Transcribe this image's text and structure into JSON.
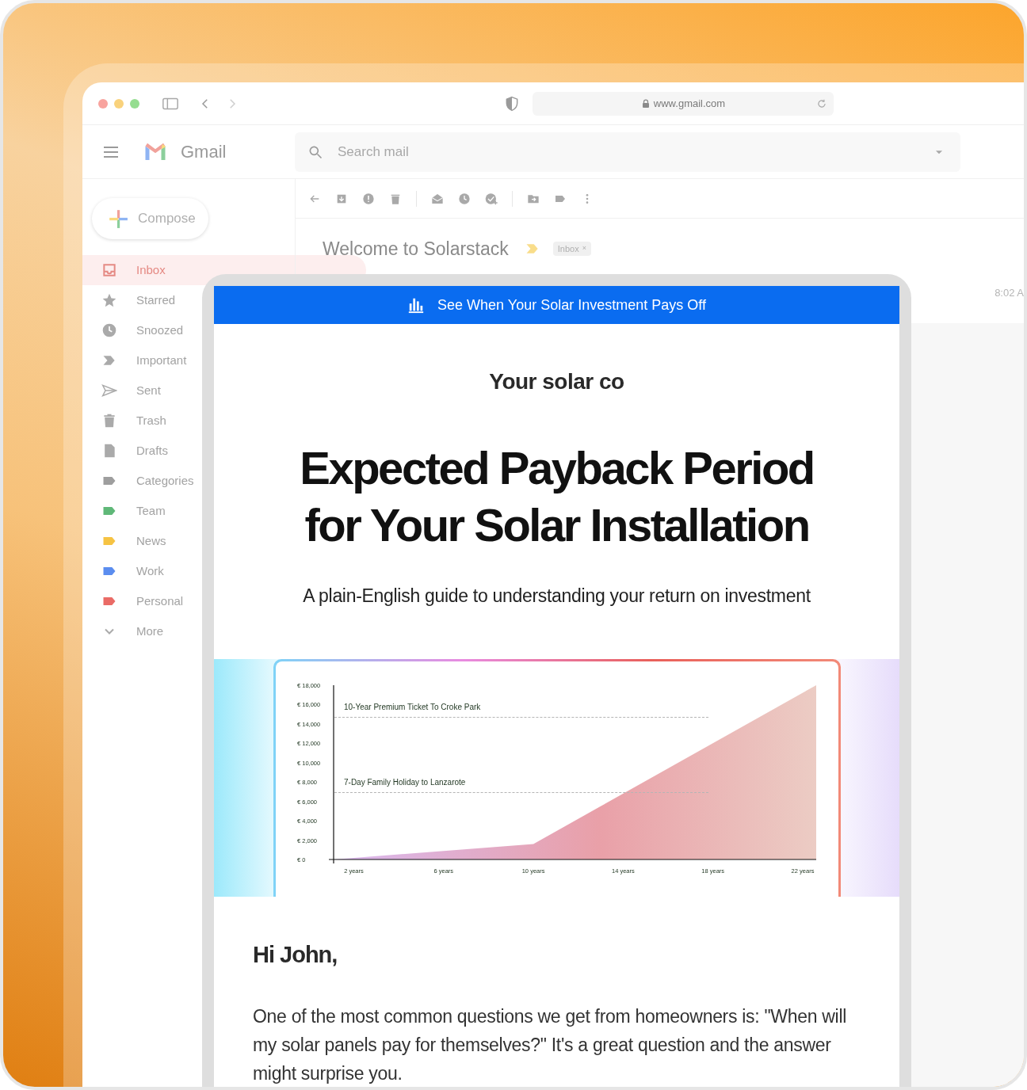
{
  "browser": {
    "url": "www.gmail.com"
  },
  "gmail": {
    "app_name": "Gmail",
    "search": {
      "placeholder": "Search mail"
    },
    "compose": "Compose",
    "sidebar": {
      "items": [
        {
          "label": "Inbox",
          "kind": "inbox",
          "selected": true
        },
        {
          "label": "Starred",
          "kind": "star",
          "selected": false
        },
        {
          "label": "Snoozed",
          "kind": "clock",
          "selected": false
        },
        {
          "label": "Important",
          "kind": "important",
          "selected": false
        },
        {
          "label": "Sent",
          "kind": "sent",
          "selected": false
        },
        {
          "label": "Trash",
          "kind": "trash",
          "selected": false
        },
        {
          "label": "Drafts",
          "kind": "draft",
          "selected": false
        },
        {
          "label": "Categories",
          "kind": "label",
          "color": "#9e9e9e",
          "selected": false
        },
        {
          "label": "Team",
          "kind": "label",
          "color": "#5fb878",
          "selected": false
        },
        {
          "label": "News",
          "kind": "label",
          "color": "#f6c343",
          "selected": false
        },
        {
          "label": "Work",
          "kind": "label",
          "color": "#5b8def",
          "selected": false
        },
        {
          "label": "Personal",
          "kind": "label",
          "color": "#ea6b66",
          "selected": false
        },
        {
          "label": "More",
          "kind": "more",
          "selected": false
        }
      ]
    },
    "thread": {
      "subject": "Welcome to Solarstack",
      "chip": "Inbox",
      "chip_close": "×",
      "time": "8:02 A"
    }
  },
  "email": {
    "banner": "See When Your Solar Investment Pays Off",
    "sender": "Your solar co",
    "headline": "Expected Payback Period for Your Solar Installation",
    "subtitle": "A plain-English guide to understanding your return on investment",
    "chart_data": {
      "type": "area",
      "x": [
        1.1,
        10,
        22.6
      ],
      "series": [
        {
          "color": "#e9a0a8",
          "values": [
            0,
            1600,
            18000
          ]
        }
      ],
      "xlim": [
        1.1,
        22.6
      ],
      "ylim": [
        0,
        18000
      ],
      "xticks": [
        {
          "value": 2,
          "label": "2 years"
        },
        {
          "value": 6,
          "label": "6 years"
        },
        {
          "value": 10,
          "label": "10 years"
        },
        {
          "value": 14,
          "label": "14 years"
        },
        {
          "value": 18,
          "label": "18 years"
        },
        {
          "value": 22,
          "label": "22 years"
        }
      ],
      "yticks": [
        {
          "value": 18000,
          "label": "€ 18,000"
        },
        {
          "value": 16000,
          "label": "€ 16,000"
        },
        {
          "value": 14000,
          "label": "€ 14,000"
        },
        {
          "value": 12000,
          "label": "€ 12,000"
        },
        {
          "value": 10000,
          "label": "€ 10,000"
        },
        {
          "value": 8000,
          "label": "€ 8,000"
        },
        {
          "value": 6000,
          "label": "€ 6,000"
        },
        {
          "value": 4000,
          "label": "€ 4,000"
        },
        {
          "value": 2000,
          "label": "€ 2,000"
        },
        {
          "value": 0,
          "label": "€ 0"
        }
      ],
      "annotations": [
        "10-Year Premium Ticket To Croke Park",
        "7-Day Family Holiday to Lanzarote"
      ]
    },
    "greeting": "Hi John,",
    "paragraph": "One of the most common questions we get from homeowners is: \"When will my solar panels pay for themselves?\" It's a great question and the answer might surprise you."
  }
}
